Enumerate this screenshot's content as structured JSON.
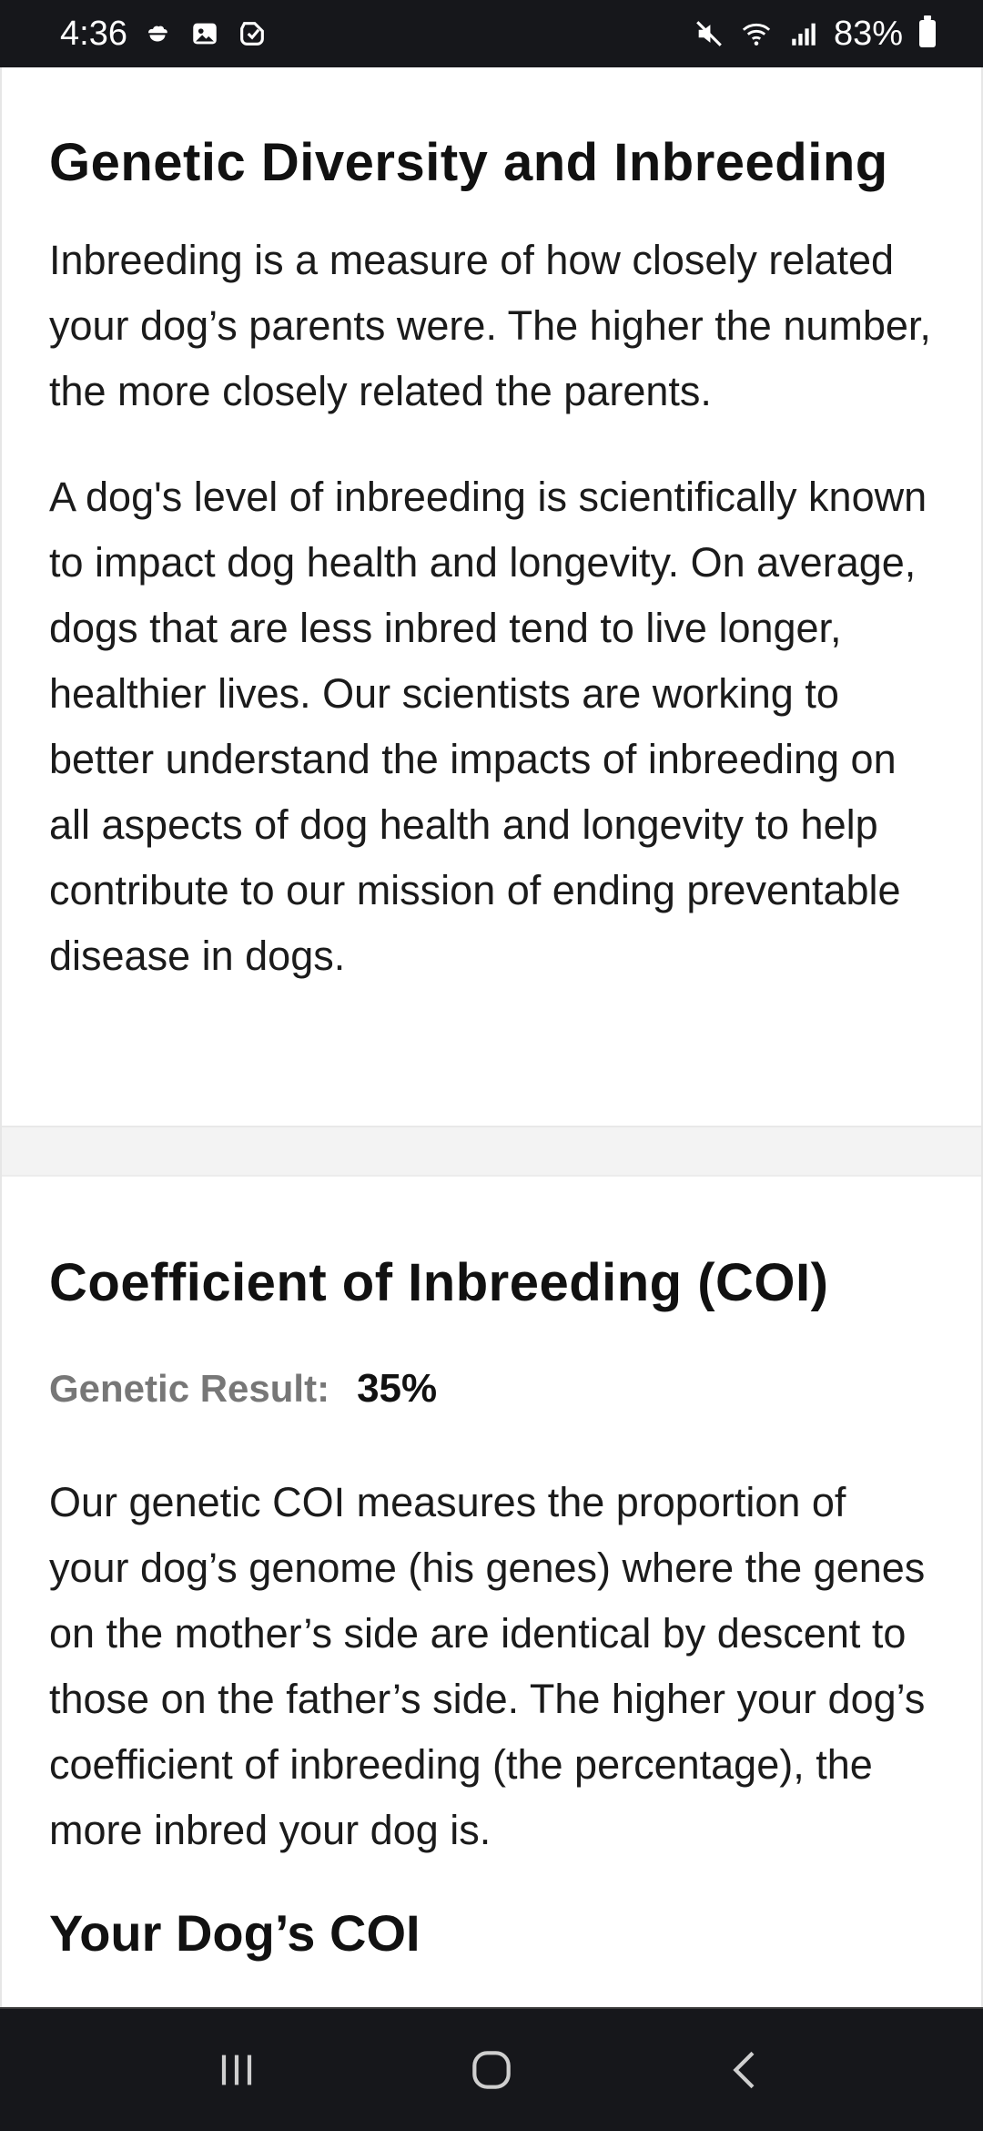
{
  "status_bar": {
    "time": "4:36",
    "battery": "83%",
    "left_icons": [
      "cloud-icon",
      "gallery-icon",
      "sticker-icon"
    ],
    "right_icons": [
      "mute-icon",
      "wifi-icon",
      "signal-icon",
      "battery-icon"
    ]
  },
  "diversity": {
    "title": "Genetic Diversity and Inbreeding",
    "paragraph_1": "Inbreeding is a measure of how closely related your dog’s parents were. The higher the number, the more closely related the parents.",
    "paragraph_2": "A dog's level of inbreeding is scientifically known to impact dog health and longevity. On average, dogs that are less inbred tend to live longer, healthier lives. Our scientists are working to better understand the impacts of inbreeding on all aspects of dog health and longevity to help contribute to our mission of ending preventable disease in dogs."
  },
  "coi": {
    "title": "Coefficient of Inbreeding (COI)",
    "result_label": "Genetic Result:",
    "result_value": "35%",
    "paragraph": "Our genetic COI measures the proportion of your dog’s genome (his genes) where the genes on the mother’s side are identical by descent to those on the father’s side. The higher your dog’s coefficient of inbreeding (the percentage), the more inbred your dog is.",
    "your_dog_heading": "Your Dog’s COI"
  },
  "nav_bar": {
    "buttons": [
      "recent-apps-icon",
      "home-icon",
      "back-icon"
    ]
  }
}
